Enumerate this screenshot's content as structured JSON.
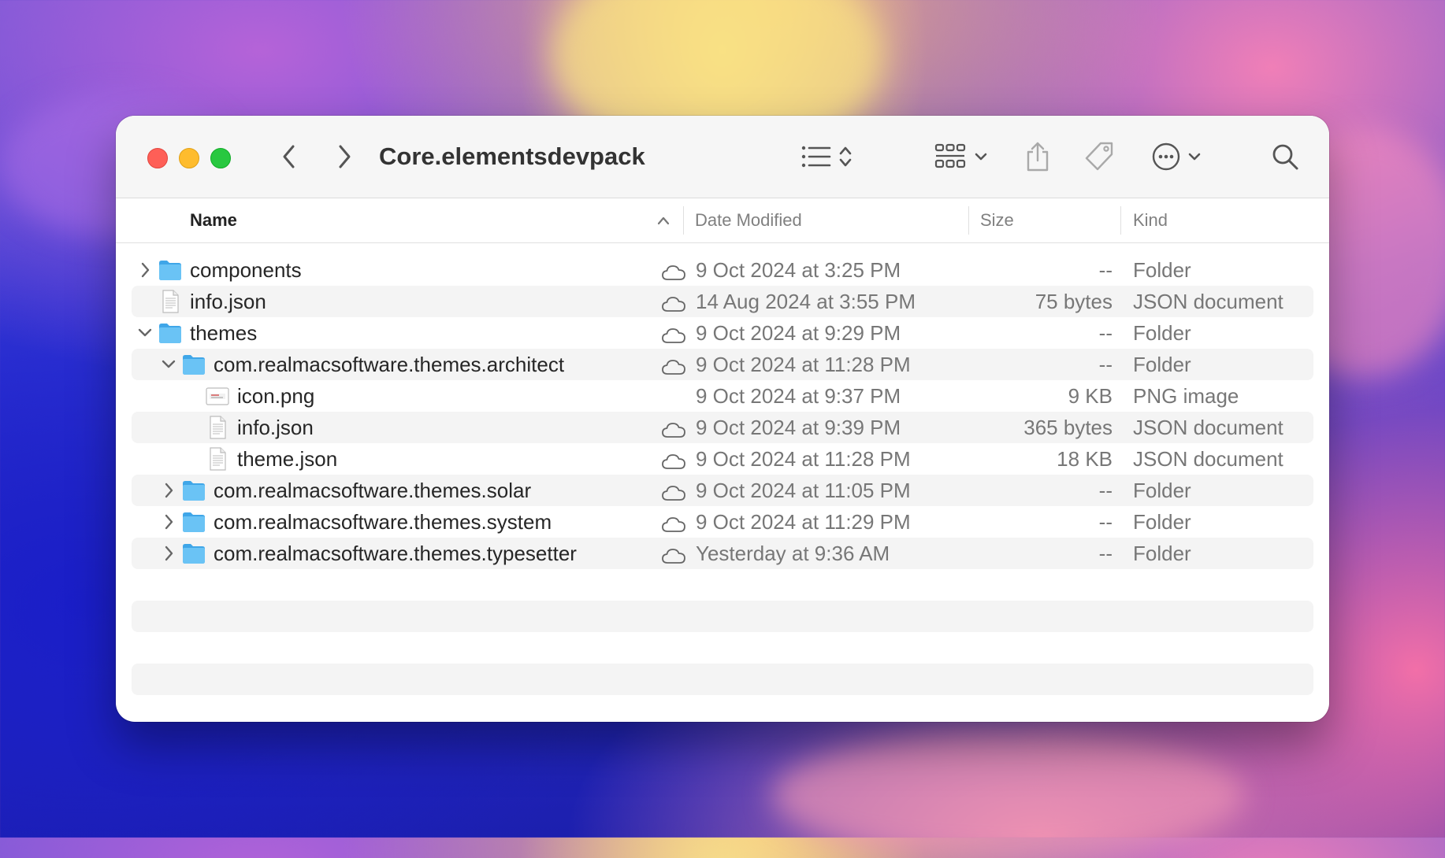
{
  "window": {
    "title": "Core.elementsdevpack"
  },
  "toolbar": {
    "back_icon": "chevron-left-icon",
    "forward_icon": "chevron-right-icon",
    "view_icon": "list-view-icon",
    "group_icon": "grid-group-icon",
    "share_icon": "share-icon",
    "tag_icon": "tag-icon",
    "more_icon": "ellipsis-circle-icon",
    "search_icon": "search-icon"
  },
  "columns": {
    "name": "Name",
    "date": "Date Modified",
    "size": "Size",
    "kind": "Kind"
  },
  "rows": [
    {
      "name": "components",
      "date": "9 Oct 2024 at 3:25 PM",
      "size": "--",
      "kind": "Folder",
      "type": "folder",
      "level": 0,
      "disclosure": "collapsed",
      "cloud": true
    },
    {
      "name": "info.json",
      "date": "14 Aug 2024 at 3:55 PM",
      "size": "75 bytes",
      "kind": "JSON document",
      "type": "doc",
      "level": 0,
      "disclosure": "none",
      "cloud": true
    },
    {
      "name": "themes",
      "date": "9 Oct 2024 at 9:29 PM",
      "size": "--",
      "kind": "Folder",
      "type": "folder",
      "level": 0,
      "disclosure": "expanded",
      "cloud": true
    },
    {
      "name": "com.realmacsoftware.themes.architect",
      "date": "9 Oct 2024 at 11:28 PM",
      "size": "--",
      "kind": "Folder",
      "type": "folder",
      "level": 1,
      "disclosure": "expanded",
      "cloud": true
    },
    {
      "name": "icon.png",
      "date": "9 Oct 2024 at 9:37 PM",
      "size": "9 KB",
      "kind": "PNG image",
      "type": "image",
      "level": 2,
      "disclosure": "none",
      "cloud": false
    },
    {
      "name": "info.json",
      "date": "9 Oct 2024 at 9:39 PM",
      "size": "365 bytes",
      "kind": "JSON document",
      "type": "doc",
      "level": 2,
      "disclosure": "none",
      "cloud": true
    },
    {
      "name": "theme.json",
      "date": "9 Oct 2024 at 11:28 PM",
      "size": "18 KB",
      "kind": "JSON document",
      "type": "doc",
      "level": 2,
      "disclosure": "none",
      "cloud": true
    },
    {
      "name": "com.realmacsoftware.themes.solar",
      "date": "9 Oct 2024 at 11:05 PM",
      "size": "--",
      "kind": "Folder",
      "type": "folder",
      "level": 1,
      "disclosure": "collapsed",
      "cloud": true
    },
    {
      "name": "com.realmacsoftware.themes.system",
      "date": "9 Oct 2024 at 11:29 PM",
      "size": "--",
      "kind": "Folder",
      "type": "folder",
      "level": 1,
      "disclosure": "collapsed",
      "cloud": true
    },
    {
      "name": "com.realmacsoftware.themes.typesetter",
      "date": "Yesterday at 9:36 AM",
      "size": "--",
      "kind": "Folder",
      "type": "folder",
      "level": 1,
      "disclosure": "collapsed",
      "cloud": true
    }
  ],
  "colors": {
    "close": "#fe5f57",
    "minimize": "#febc2e",
    "zoom": "#28c840",
    "folder": "#5ab8f0"
  }
}
